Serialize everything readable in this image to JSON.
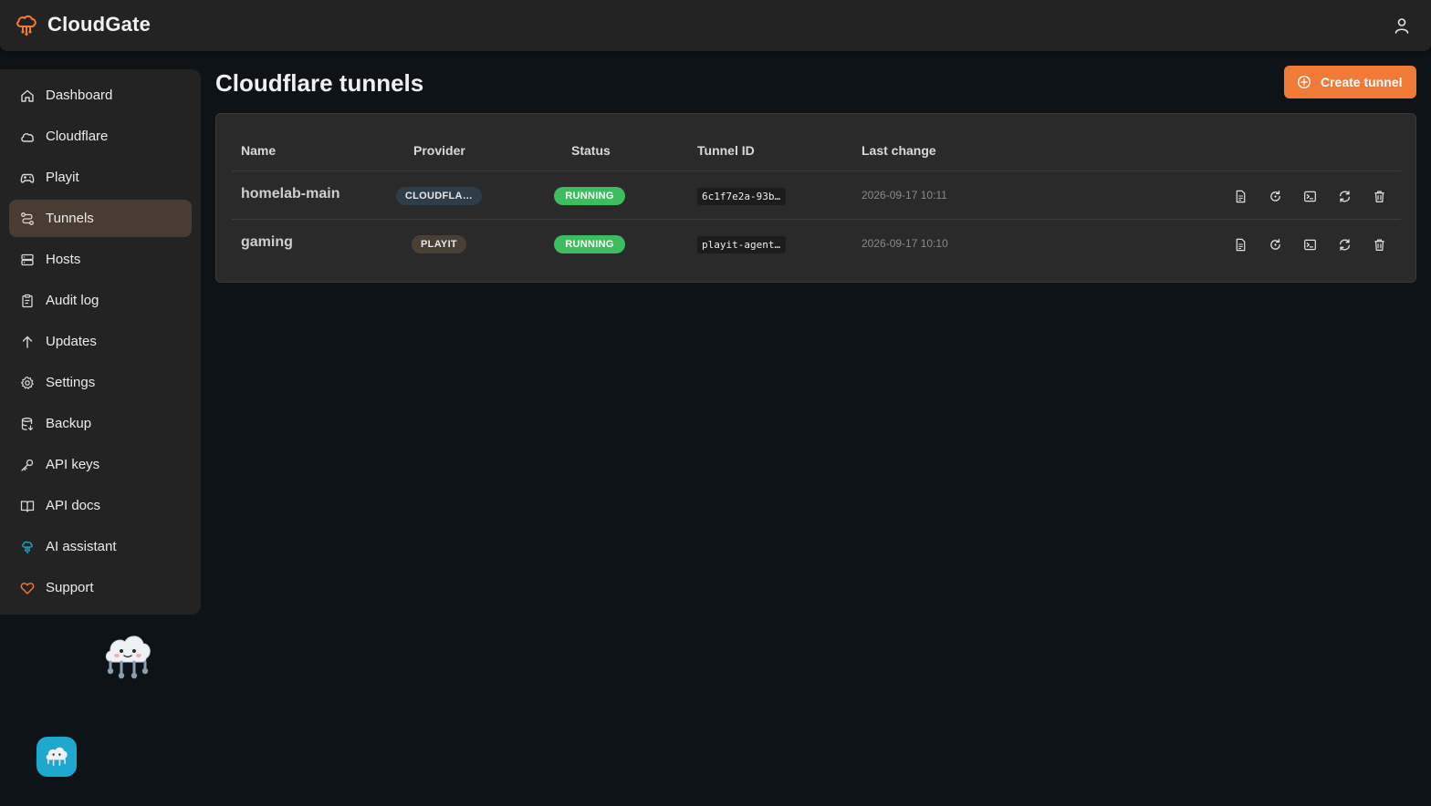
{
  "app": {
    "title": "CloudGate"
  },
  "colors": {
    "accent": "#f27a37",
    "running": "#3dbd5d",
    "active_nav": "#4a3b33",
    "assistant": "#1fa8cf"
  },
  "sidebar": {
    "items": [
      {
        "label": "Dashboard",
        "icon": "home-icon"
      },
      {
        "label": "Cloudflare",
        "icon": "cloud-icon"
      },
      {
        "label": "Playit",
        "icon": "gamepad-icon"
      },
      {
        "label": "Tunnels",
        "icon": "route-icon",
        "active": true
      },
      {
        "label": "Hosts",
        "icon": "server-icon"
      },
      {
        "label": "Audit log",
        "icon": "clipboard-icon"
      },
      {
        "label": "Updates",
        "icon": "arrow-up-icon"
      },
      {
        "label": "Settings",
        "icon": "gear-icon"
      },
      {
        "label": "Backup",
        "icon": "database-icon"
      },
      {
        "label": "API keys",
        "icon": "key-icon"
      },
      {
        "label": "API docs",
        "icon": "book-icon"
      },
      {
        "label": "AI assistant",
        "icon": "robot-icon"
      },
      {
        "label": "Support",
        "icon": "heart-icon"
      }
    ]
  },
  "main": {
    "title": "Cloudflare tunnels",
    "create_label": "Create tunnel",
    "columns": [
      "Name",
      "Provider",
      "Status",
      "Tunnel ID",
      "Last change"
    ],
    "rows": [
      {
        "name": "homelab-main",
        "provider": "CLOUDFLA…",
        "status": "RUNNING",
        "tunnel_id": "6c1f7e2a-93b…",
        "last_change": "2026-09-17 10:11"
      },
      {
        "name": "gaming",
        "provider": "PLAYIT",
        "status": "RUNNING",
        "tunnel_id": "playit-agent…",
        "last_change": "2026-09-17 10:10"
      }
    ],
    "row_actions": [
      "logs-icon",
      "restart-icon",
      "terminal-icon",
      "sync-icon",
      "trash-icon"
    ]
  }
}
